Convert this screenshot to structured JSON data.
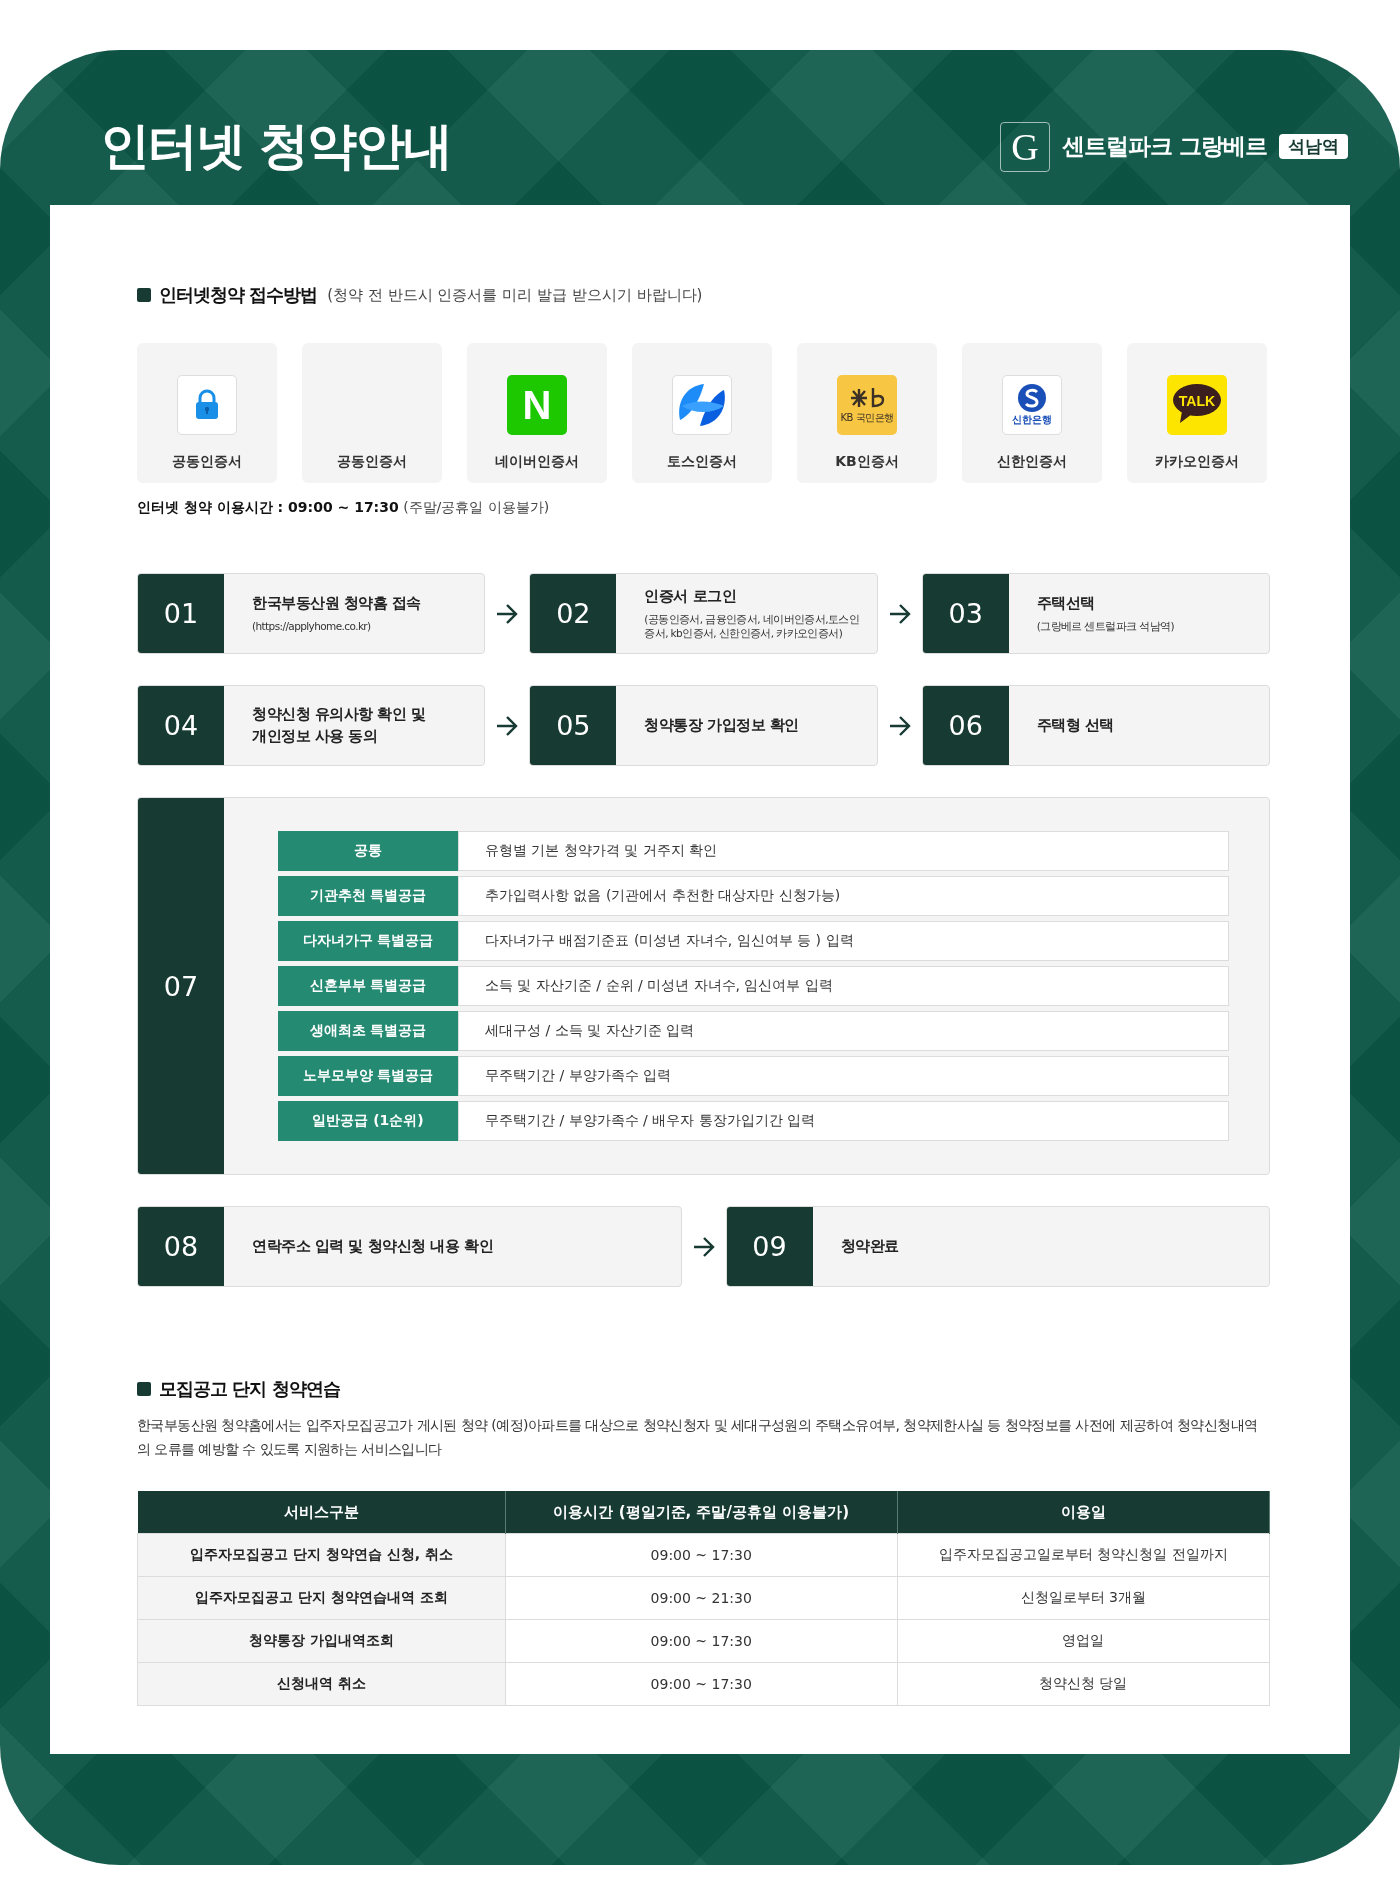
{
  "header": {
    "title": "인터넷 청약안내",
    "logo_letter": "G",
    "brand": "센트럴파크 그랑베르",
    "badge": "석남역"
  },
  "method": {
    "title": "인터넷청약 접수방법",
    "note": "(청약 전 반드시 인증서를 미리 발급 받으시기 바랍니다)",
    "certificates": [
      {
        "kind": "lock",
        "label": "공동인증서"
      },
      {
        "kind": "blank",
        "label": "공동인증서"
      },
      {
        "kind": "naver",
        "logo_text": "N",
        "label": "네이버인증서"
      },
      {
        "kind": "toss",
        "label": "토스인증서"
      },
      {
        "kind": "kb",
        "logo_text": "KB 국민은행",
        "label": "KB인증서"
      },
      {
        "kind": "shinhan",
        "logo_text": "신한은행",
        "label": "신한인증서"
      },
      {
        "kind": "kakao",
        "logo_text": "TALK",
        "label": "카카오인증서"
      }
    ],
    "hours": {
      "label": "인터넷 청약 이용시간 : 09:00 ~ 17:30",
      "note": "(주말/공휴일 이용불가)"
    }
  },
  "step_rows": [
    {
      "steps": [
        {
          "kind": "text",
          "number": "01",
          "title": "한국부동산원 청약홈 접속",
          "detail": "(https://applyhome.co.kr)"
        },
        {
          "kind": "text",
          "number": "02",
          "title": "인증서 로그인",
          "detail": "(공동인증서, 금융인증서, 네이버인증서,토스인증서, kb인증서, 신한인증서, 카카오인증서)"
        },
        {
          "kind": "text",
          "number": "03",
          "title": "주택선택",
          "detail": "(그랑베르 센트럴파크 석남역)"
        }
      ]
    },
    {
      "steps": [
        {
          "kind": "text",
          "number": "04",
          "title": "청약신청 유의사항 확인 및 개인정보 사용 동의"
        },
        {
          "kind": "text",
          "number": "05",
          "title": "청약통장 가입정보 확인"
        },
        {
          "kind": "text",
          "number": "06",
          "title": "주택형 선택"
        }
      ]
    },
    {
      "steps": [
        {
          "kind": "list",
          "number": "07",
          "items": [
            {
              "label": "공통",
              "description": "유형별 기본 청약가격 및 거주지 확인"
            },
            {
              "label": "기관추천 특별공급",
              "description": "추가입력사항 없음 (기관에서 추천한 대상자만 신청가능)"
            },
            {
              "label": "다자녀가구 특별공급",
              "description": "다자녀가구 배점기준표 (미성년 자녀수, 임신여부 등 ) 입력"
            },
            {
              "label": "신혼부부 특별공급",
              "description": "소득 및 자산기준 / 순위 / 미성년 자녀수, 임신여부 입력"
            },
            {
              "label": "생애최초 특별공급",
              "description": "세대구성 / 소득 및 자산기준 입력"
            },
            {
              "label": "노부모부양 특별공급",
              "description": "무주택기간 / 부양가족수 입력"
            },
            {
              "label": "일반공급 (1순위)",
              "description": "무주택기간 / 부양가족수 / 배우자 통장가입기간 입력"
            }
          ]
        }
      ]
    },
    {
      "steps": [
        {
          "kind": "text",
          "number": "08",
          "title": "연락주소 입력 및 청약신청 내용 확인"
        },
        {
          "kind": "text",
          "number": "09",
          "title": "청약완료"
        }
      ]
    }
  ],
  "practice": {
    "title": "모집공고 단지 청약연습",
    "description": "한국부동산원 청약홈에서는 입주자모집공고가 게시된 청약 (예정)아파트를 대상으로 청약신청자 및 세대구성원의 주택소유여부, 청약제한사실 등 청약정보를 사전에 제공하여 청약신청내역의 오류를 예방할 수 있도록 지원하는 서비스입니다",
    "table": {
      "columns": [
        "서비스구분",
        "이용시간 (평일기준, 주말/공휴일 이용불가)",
        "이용일"
      ],
      "rows": [
        [
          "입주자모집공고 단지 청약연습 신청, 취소",
          "09:00 ~ 17:30",
          "입주자모집공고일로부터 청약신청일 전일까지"
        ],
        [
          "입주자모집공고 단지 청약연습내역 조회",
          "09:00 ~ 21:30",
          "신청일로부터 3개월"
        ],
        [
          "청약통장 가입내역조회",
          "09:00 ~ 17:30",
          "영업일"
        ],
        [
          "신청내역 취소",
          "09:00 ~ 17:30",
          "청약신청 당일"
        ]
      ]
    }
  }
}
